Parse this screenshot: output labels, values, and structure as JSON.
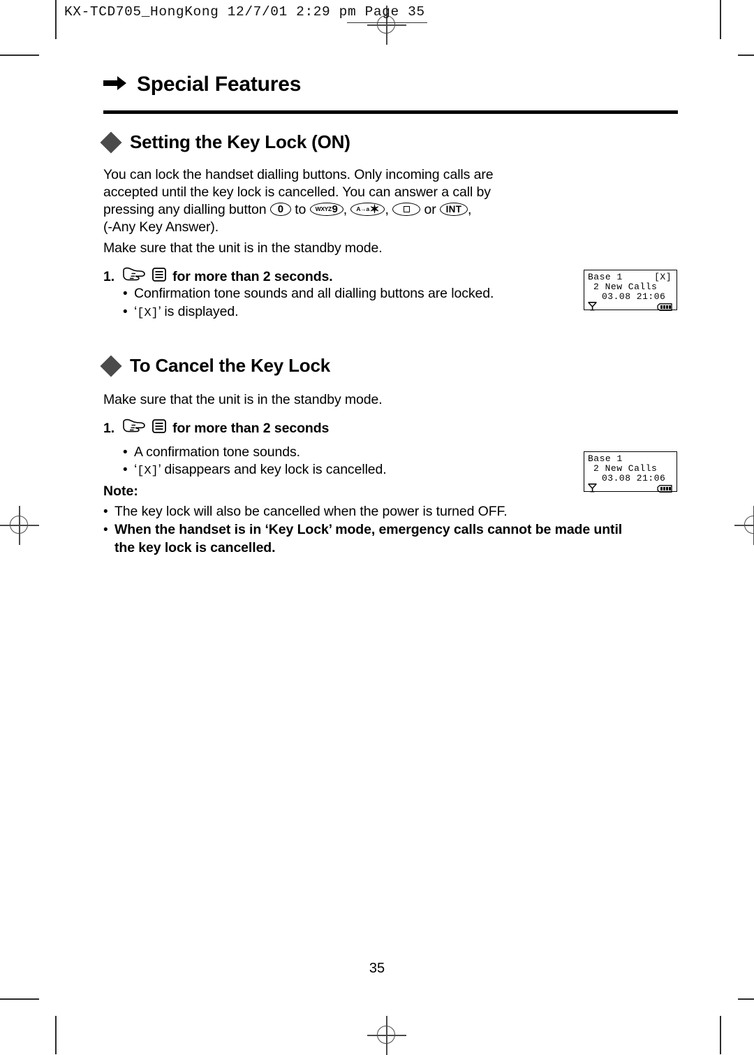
{
  "print_slug": {
    "text": "KX-TCD705_HongKong   12/7/01   2:29 pm   Page 35"
  },
  "chapter": {
    "arrow_icon": "right-arrow-icon",
    "title": "Special Features"
  },
  "sections": [
    {
      "bullet_icon": "diamond-bullet-icon",
      "title": "Setting the Key Lock (ON)",
      "intro_lines": [
        "You can lock the handset dialling buttons. Only incoming calls are",
        "accepted until the key lock is cancelled. You can answer a call by",
        "pressing any dialling button",
        "(-Any Key Answer)."
      ],
      "inline_keys": {
        "key_zero": "0",
        "to_word": "to",
        "key_nine_sup": "WXYZ",
        "key_nine": "9",
        "key_star_sup": "A→a",
        "key_star": "✶",
        "key_square_icon": "square-key-icon",
        "or_word": "or",
        "key_int": "INT",
        "comma": ","
      },
      "standby_note": "Make sure that the unit is in the standby mode.",
      "step": {
        "number": "1.",
        "hand_icon": "pointing-hand-icon",
        "menu_icon": "menu-button-icon",
        "label": "for more than 2 seconds."
      },
      "bullets": [
        {
          "dot": "•",
          "pre": "Confirmation tone sounds and all dialling buttons are locked.",
          "mono": "",
          "post": ""
        },
        {
          "dot": "•",
          "pre": "‘",
          "mono": "[X]",
          "post": "’ is displayed."
        }
      ],
      "lcd": {
        "line1_left": "Base 1",
        "line1_flag": "[X]",
        "line2": "2 New Calls",
        "line3": "03.08 21:06",
        "antenna_icon": "antenna-icon",
        "battery_icon": "battery-icon"
      }
    },
    {
      "bullet_icon": "diamond-bullet-icon",
      "title": "To Cancel the Key Lock",
      "standby_note": "Make sure that the unit is in the standby mode.",
      "step": {
        "number": "1.",
        "hand_icon": "pointing-hand-icon",
        "menu_icon": "menu-button-icon",
        "label": "for more than 2 seconds"
      },
      "bullets": [
        {
          "dot": "•",
          "pre": "A confirmation tone sounds.",
          "mono": "",
          "post": ""
        },
        {
          "dot": "•",
          "pre": "‘",
          "mono": "[X]",
          "post": "’ disappears and key lock is cancelled."
        }
      ],
      "lcd": {
        "line1_left": "Base 1",
        "line1_flag": "",
        "line2": "2 New Calls",
        "line3": "03.08 21:06",
        "antenna_icon": "antenna-icon",
        "battery_icon": "battery-icon"
      }
    }
  ],
  "note": {
    "label": "Note:",
    "bullets": [
      {
        "dot": "•",
        "bold": false,
        "lines": [
          "The key lock will also be cancelled when the power is turned OFF."
        ]
      },
      {
        "dot": "•",
        "bold": true,
        "lines": [
          "When the handset is in ‘Key Lock’ mode, emergency calls cannot be made until",
          "the key lock is cancelled."
        ]
      }
    ]
  },
  "page_number": "35",
  "colors": {
    "text": "#000000",
    "diamond": "#4b4b4b",
    "crop_mark": "#2b2b2b",
    "registration": "#4a4a4a"
  }
}
